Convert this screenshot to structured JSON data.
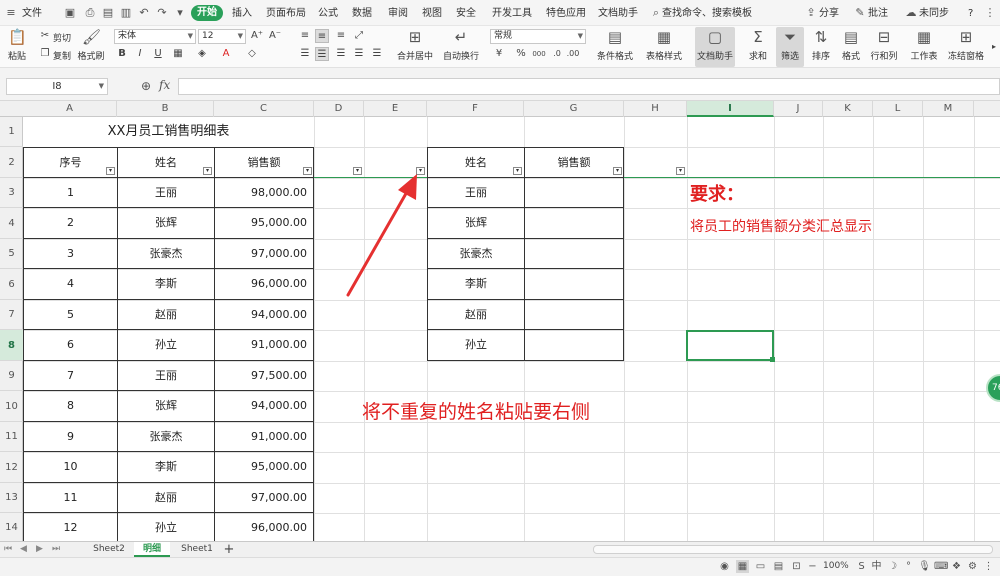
{
  "menu": {
    "file": "文件",
    "tabs": [
      "开始",
      "插入",
      "页面布局",
      "公式",
      "数据",
      "审阅",
      "视图",
      "安全",
      "开发工具",
      "特色应用",
      "文档助手"
    ],
    "search": "查找命令、搜索模板",
    "share": "分享",
    "comment": "批注",
    "sync": "未同步",
    "help": "?"
  },
  "ribbon": {
    "paste": "粘贴",
    "cut": "剪切",
    "copy": "复制",
    "format_painter": "格式刷",
    "font_name": "宋体",
    "font_size": "12",
    "merge_center": "合并居中",
    "wrap_text": "自动换行",
    "number_format": "常规",
    "conditional_format": "条件格式",
    "table_style": "表格样式",
    "doc_assistant": "文档助手",
    "sum": "求和",
    "filter": "筛选",
    "sort": "排序",
    "format": "格式",
    "row_col": "行和列",
    "worksheet": "工作表",
    "freeze": "冻结窗格",
    "icons": {
      "bold": "B",
      "italic": "I",
      "underline": "U",
      "percent": "%",
      "currency": "¥",
      "comma": "000",
      "sigma": "Σ",
      "increase_font": "A⁺",
      "decrease_font": "A⁻"
    }
  },
  "formula_bar": {
    "name_box": "I8",
    "fx": "fx",
    "formula": ""
  },
  "columns": [
    "A",
    "B",
    "C",
    "D",
    "E",
    "F",
    "G",
    "H",
    "I",
    "J",
    "K",
    "L",
    "M"
  ],
  "rows": [
    "1",
    "2",
    "3",
    "4",
    "5",
    "6",
    "7",
    "8",
    "9",
    "10",
    "11",
    "12",
    "13",
    "14"
  ],
  "sheet": {
    "title": "XX月员工销售明细表",
    "headers": {
      "seq": "序号",
      "name": "姓名",
      "sales": "销售额"
    },
    "data": [
      {
        "seq": "1",
        "name": "王丽",
        "sales": "98,000.00"
      },
      {
        "seq": "2",
        "name": "张辉",
        "sales": "95,000.00"
      },
      {
        "seq": "3",
        "name": "张豪杰",
        "sales": "97,000.00"
      },
      {
        "seq": "4",
        "name": "李斯",
        "sales": "96,000.00"
      },
      {
        "seq": "5",
        "name": "赵丽",
        "sales": "94,000.00"
      },
      {
        "seq": "6",
        "name": "孙立",
        "sales": "91,000.00"
      },
      {
        "seq": "7",
        "name": "王丽",
        "sales": "97,500.00"
      },
      {
        "seq": "8",
        "name": "张辉",
        "sales": "94,000.00"
      },
      {
        "seq": "9",
        "name": "张豪杰",
        "sales": "91,000.00"
      },
      {
        "seq": "10",
        "name": "李斯",
        "sales": "95,000.00"
      },
      {
        "seq": "11",
        "name": "赵丽",
        "sales": "97,000.00"
      },
      {
        "seq": "12",
        "name": "孙立",
        "sales": "96,000.00"
      }
    ],
    "summary": {
      "name_header": "姓名",
      "sales_header": "销售额",
      "names": [
        "王丽",
        "张辉",
        "张豪杰",
        "李斯",
        "赵丽",
        "孙立"
      ]
    },
    "requirement_title": "要求：",
    "requirement_text": "将员工的销售额分类汇总显示",
    "annotation": "将不重复的姓名粘贴要右侧",
    "filter_glyph": "▾"
  },
  "tabs": [
    "Sheet2",
    "明细",
    "Sheet1"
  ],
  "add_sheet": "+",
  "status": {
    "zoom": "100%",
    "side_badge": "76"
  },
  "colors": {
    "accent_green": "#2d9a52",
    "annotation_red": "#e02020",
    "arrow_red": "#e53030"
  }
}
